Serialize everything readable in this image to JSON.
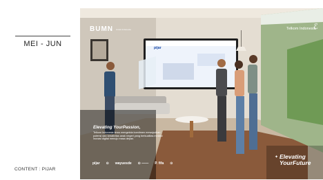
{
  "slide": {
    "period": "MEI - JUN",
    "content_label": "CONTENT : PIJAR"
  },
  "image": {
    "bumn_logo": "BUMN",
    "bumn_sub": "Untuk Indonesia",
    "telkom_logo": "Telkom Indonesia",
    "screen_brand": "pijar",
    "tagline_title": "Elevating YourPassion,",
    "tagline_body": "Telkom Indonesia terus mengelola komitmen mewujudkan potensi dan kreativitas anak negeri yang berkualitas melalui inovasi digital menuju masa depan.",
    "partners": [
      "pijar",
      "⊙",
      "wayuesde",
      "⊙ ——",
      "P. fifa",
      "⊙"
    ],
    "slogan_line1": "Elevating",
    "slogan_line2": "YourFuture",
    "colors": {
      "accent": "#e07a2b",
      "screen_blue": "#1a4aa8",
      "floor": "#8a5a3b"
    }
  }
}
